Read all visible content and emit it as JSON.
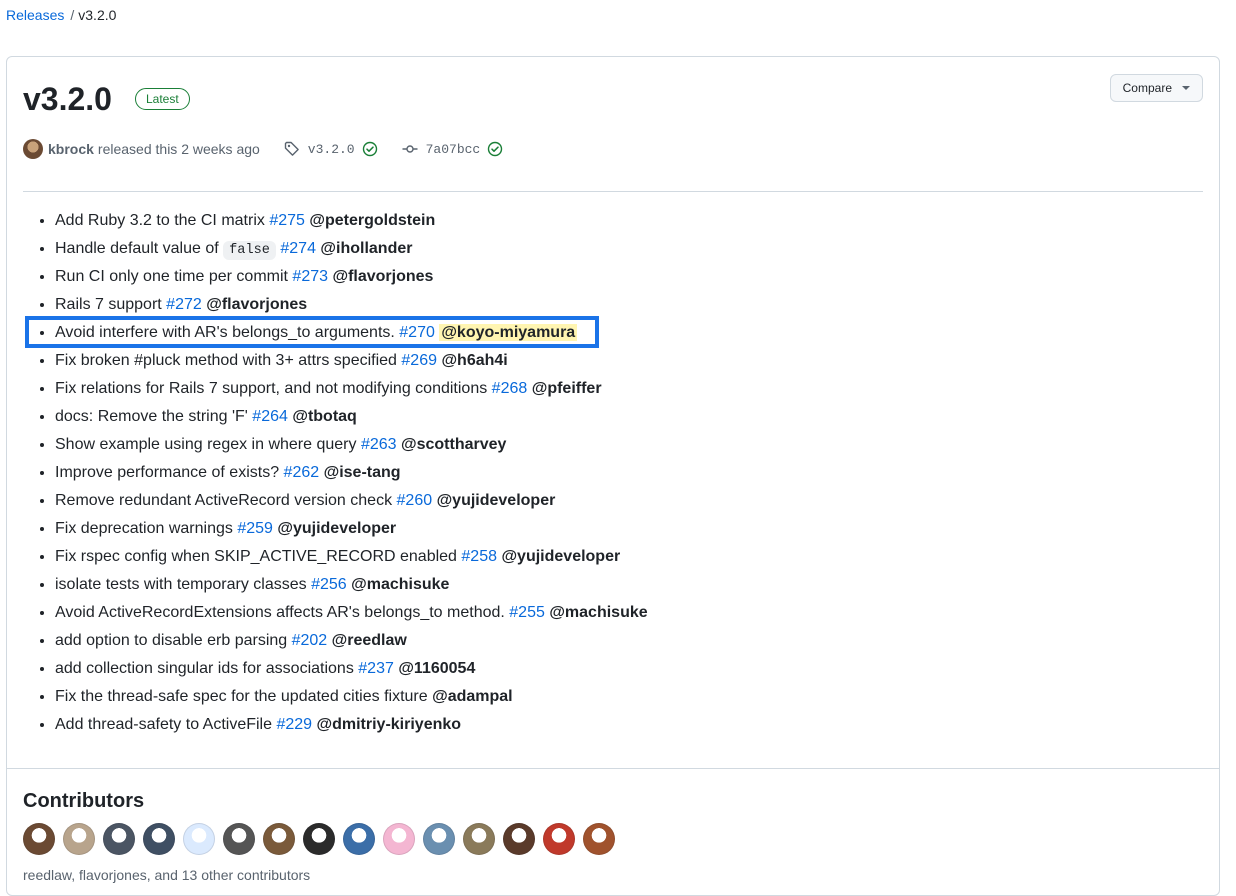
{
  "breadcrumb": {
    "releases": "Releases",
    "separator": "/",
    "current": "v3.2.0"
  },
  "release": {
    "title": "v3.2.0",
    "badge": "Latest",
    "compare_label": "Compare",
    "author": "kbrock",
    "released_text": "released this 2 weeks ago",
    "tag": "v3.2.0",
    "commit": "7a07bcc"
  },
  "notes": [
    {
      "text": "Add Ruby 3.2 to the CI matrix ",
      "pr": "#275",
      "user": "@petergoldstein"
    },
    {
      "text": "Handle default value of ",
      "code": "false",
      "pr": "#274",
      "user": "@ihollander"
    },
    {
      "text": "Run CI only one time per commit ",
      "pr": "#273",
      "user": "@flavorjones"
    },
    {
      "text": "Rails 7 support ",
      "pr": "#272",
      "user": "@flavorjones"
    },
    {
      "text": "Avoid interfere with AR's belongs_to arguments. ",
      "pr": "#270",
      "user": "@koyo-miyamura",
      "highlighted": true
    },
    {
      "text": "Fix broken #pluck method with 3+ attrs specified ",
      "pr": "#269",
      "user": "@h6ah4i"
    },
    {
      "text": "Fix relations for Rails 7 support, and not modifying conditions ",
      "pr": "#268",
      "user": "@pfeiffer"
    },
    {
      "text": "docs: Remove the string 'F' ",
      "pr": "#264",
      "user": "@tbotaq"
    },
    {
      "text": "Show example using regex in where query ",
      "pr": "#263",
      "user": "@scottharvey"
    },
    {
      "text": "Improve performance of exists? ",
      "pr": "#262",
      "user": "@ise-tang"
    },
    {
      "text": "Remove redundant ActiveRecord version check ",
      "pr": "#260",
      "user": "@yujideveloper"
    },
    {
      "text": "Fix deprecation warnings ",
      "pr": "#259",
      "user": "@yujideveloper"
    },
    {
      "text": "Fix rspec config when SKIP_ACTIVE_RECORD enabled ",
      "pr": "#258",
      "user": "@yujideveloper"
    },
    {
      "text": "isolate tests with temporary classes ",
      "pr": "#256",
      "user": "@machisuke"
    },
    {
      "text": "Avoid ActiveRecordExtensions affects AR's belongs_to method. ",
      "pr": "#255",
      "user": "@machisuke"
    },
    {
      "text": "add option to disable erb parsing ",
      "pr": "#202",
      "user": "@reedlaw"
    },
    {
      "text": "add collection singular ids for associations ",
      "pr": "#237",
      "user": "@1160054"
    },
    {
      "text": "Fix the thread-safe spec for the updated cities fixture ",
      "user": "@adampal"
    },
    {
      "text": "Add thread-safety to ActiveFile ",
      "pr": "#229",
      "user": "@dmitriy-kiriyenko"
    }
  ],
  "contributors": {
    "title": "Contributors",
    "summary": "reedlaw, flavorjones, and 13 other contributors",
    "avatar_colors": [
      "#6b4a33",
      "#b8a48c",
      "#4b5563",
      "#3f4f63",
      "#dbeafe",
      "#555555",
      "#7a5a3a",
      "#2b2b2b",
      "#3b6ea8",
      "#f4b6d2",
      "#6a8fb0",
      "#8a7a5a",
      "#5a3a2a",
      "#c0392b",
      "#a0522d"
    ]
  },
  "colors": {
    "link": "#0969da",
    "success": "#1a7f37",
    "highlight_border": "#1a73e8",
    "highlight_fill": "#fff5b1"
  }
}
